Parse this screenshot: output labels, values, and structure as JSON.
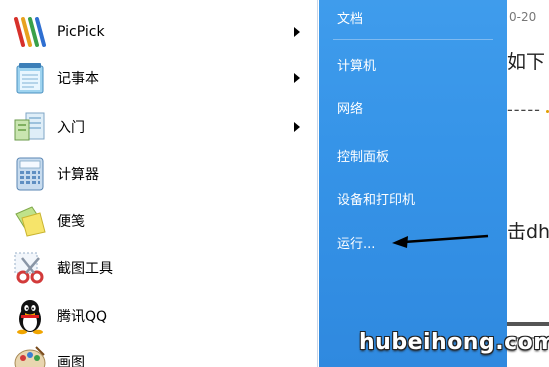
{
  "start_menu": {
    "programs": [
      {
        "label": "PicPick",
        "icon": "picpick-icon",
        "has_submenu": true
      },
      {
        "label": "记事本",
        "icon": "notepad-icon",
        "has_submenu": true
      },
      {
        "label": "入门",
        "icon": "getting-started-icon",
        "has_submenu": true
      },
      {
        "label": "计算器",
        "icon": "calculator-icon",
        "has_submenu": false
      },
      {
        "label": "便笺",
        "icon": "sticky-notes-icon",
        "has_submenu": false
      },
      {
        "label": "截图工具",
        "icon": "snipping-tool-icon",
        "has_submenu": false
      },
      {
        "label": "腾讯QQ",
        "icon": "qq-icon",
        "has_submenu": false
      },
      {
        "label": "画图",
        "icon": "paint-icon",
        "has_submenu": false
      }
    ],
    "right_items": [
      {
        "label": "文档"
      },
      {
        "label": "计算机"
      },
      {
        "label": "网络"
      },
      {
        "label": "控制面板"
      },
      {
        "label": "设备和打印机"
      },
      {
        "label": "运行..."
      }
    ],
    "right_pane_color": "#3694e8"
  },
  "background_doc": {
    "date_fragment": "0-20",
    "text_fragment_1": "如下",
    "dashes": "-----",
    "text_fragment_2": "击dh"
  },
  "watermark": "hubeihong.com"
}
